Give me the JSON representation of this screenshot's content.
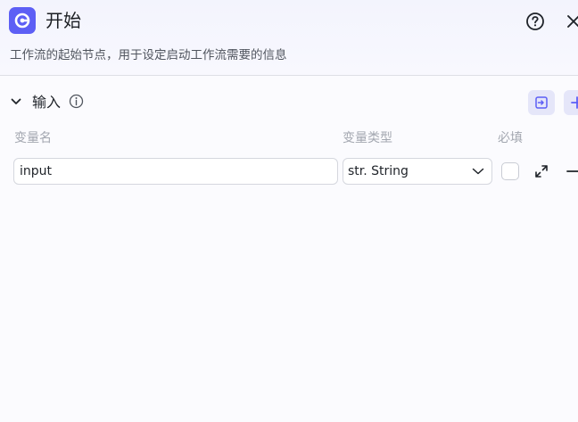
{
  "header": {
    "title": "开始",
    "description": "工作流的起始节点，用于设定启动工作流需要的信息",
    "icons": {
      "node": "start-node-icon",
      "help": "question-circle-icon",
      "close": "close-icon"
    }
  },
  "input_section": {
    "title": "输入",
    "columns": {
      "name": "变量名",
      "type": "变量类型",
      "required": "必填"
    },
    "rows": [
      {
        "name": "input",
        "type": "str. String",
        "required": false
      }
    ]
  },
  "colors": {
    "accent": "#5d5ff5",
    "accent_light": "#e5e6f9"
  }
}
